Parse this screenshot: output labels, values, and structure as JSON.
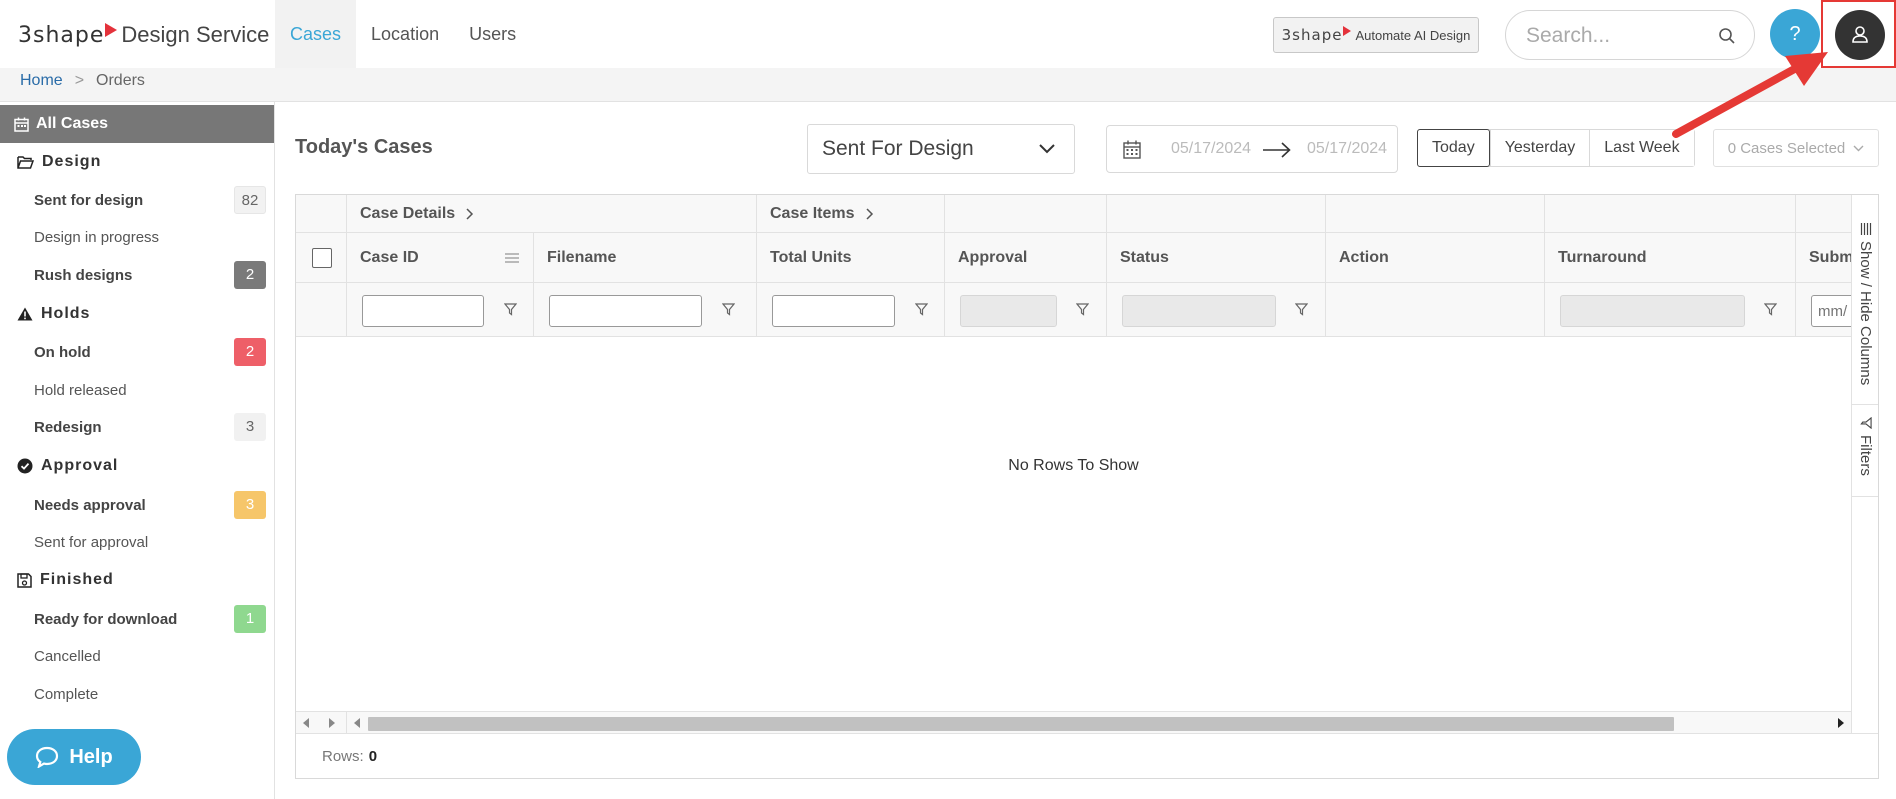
{
  "header": {
    "brand": "3shape",
    "product": "Design Service",
    "nav": [
      {
        "label": "Cases",
        "active": true
      },
      {
        "label": "Location",
        "active": false
      },
      {
        "label": "Users",
        "active": false
      }
    ],
    "automate_badge": {
      "brand": "3shape",
      "label": "Automate AI Design"
    },
    "search_placeholder": "Search...",
    "help_label": "?"
  },
  "breadcrumb": {
    "home": "Home",
    "separator": ">",
    "current": "Orders"
  },
  "sidebar": {
    "all_cases": "All Cases",
    "groups": [
      {
        "label": "Design",
        "icon": "folder-open-icon",
        "items": [
          {
            "label": "Sent for design",
            "count": "82",
            "bold": true,
            "badge": "plain"
          },
          {
            "label": "Design in progress",
            "count": "",
            "bold": false,
            "badge": ""
          },
          {
            "label": "Rush designs",
            "count": "2",
            "bold": true,
            "badge": "gray"
          }
        ]
      },
      {
        "label": "Holds",
        "icon": "warning-icon",
        "items": [
          {
            "label": "On hold",
            "count": "2",
            "bold": true,
            "badge": "red"
          },
          {
            "label": "Hold released",
            "count": "",
            "bold": false,
            "badge": ""
          },
          {
            "label": "Redesign",
            "count": "3",
            "bold": true,
            "badge": "light"
          }
        ]
      },
      {
        "label": "Approval",
        "icon": "check-circle-icon",
        "items": [
          {
            "label": "Needs approval",
            "count": "3",
            "bold": true,
            "badge": "orange"
          },
          {
            "label": "Sent for approval",
            "count": "",
            "bold": false,
            "badge": ""
          }
        ]
      },
      {
        "label": "Finished",
        "icon": "floppy-disk-icon",
        "items": [
          {
            "label": "Ready for download",
            "count": "1",
            "bold": true,
            "badge": "green"
          },
          {
            "label": "Cancelled",
            "count": "",
            "bold": false,
            "badge": ""
          },
          {
            "label": "Complete",
            "count": "",
            "bold": false,
            "badge": ""
          }
        ]
      }
    ],
    "help_button": "Help"
  },
  "main": {
    "title": "Today's Cases",
    "status_filter": "Sent For Design",
    "date_from": "05/17/2024",
    "date_to": "05/17/2024",
    "range_buttons": [
      {
        "label": "Today",
        "active": true
      },
      {
        "label": "Yesterday",
        "active": false
      },
      {
        "label": "Last Week",
        "active": false
      }
    ],
    "cases_selected": "0 Cases Selected"
  },
  "grid": {
    "group_headers": [
      "Case Details",
      "Case Items"
    ],
    "columns": [
      "Case ID",
      "Filename",
      "Total Units",
      "Approval",
      "Status",
      "Action",
      "Turnaround",
      "Submi"
    ],
    "date_filter_placeholder": "mm/",
    "empty_message": "No Rows To Show",
    "side_tabs": [
      "Show / Hide Columns",
      "Filters"
    ],
    "rows_label": "Rows:",
    "rows_count": "0"
  },
  "colors": {
    "accent": "#3aa6d6",
    "sidebar_active": "#777777",
    "annotation": "#e53935"
  }
}
